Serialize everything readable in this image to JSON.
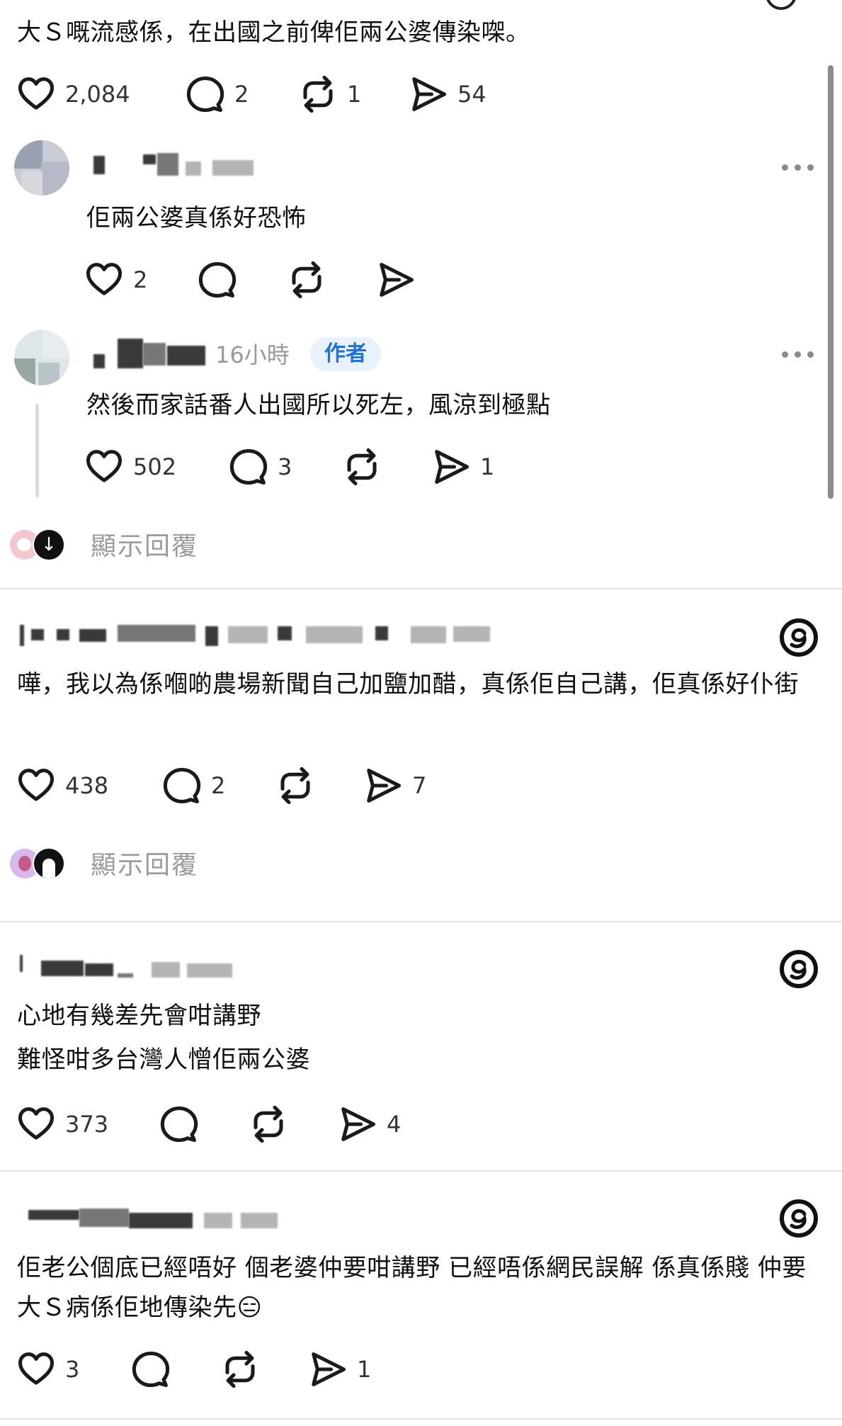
{
  "post": {
    "text": "大Ｓ嘅流感係，在出國之前俾佢兩公婆傳染㗎。",
    "likes": "2,084",
    "comments": "2",
    "reposts": "1",
    "shares": "54"
  },
  "replies": [
    {
      "text": "佢兩公婆真係好恐怖",
      "likes": "2",
      "comments": "",
      "reposts": "",
      "shares": ""
    },
    {
      "time": "16小時",
      "badge": "作者",
      "text": "然後而家話番人出國所以死左，風涼到極點",
      "likes": "502",
      "comments": "3",
      "reposts": "",
      "shares": "1"
    }
  ],
  "show_replies_label": "顯示回覆",
  "comments": [
    {
      "text": "嘩，我以為係嗰啲農場新聞自己加鹽加醋，真係佢自己講，佢真係好仆街",
      "likes": "438",
      "comments": "2",
      "reposts": "",
      "shares": "7",
      "show_replies": "顯示回覆"
    },
    {
      "text_lines": [
        "心地有幾差先會咁講野",
        "難怪咁多台灣人憎佢兩公婆"
      ],
      "likes": "373",
      "comments": "",
      "reposts": "",
      "shares": "4"
    },
    {
      "text": "佢老公個底已經唔好 個老婆仲要咁講野 已經唔係網民誤解 係真係賤 仲要大Ｓ病係佢地傳染先😑",
      "likes": "3",
      "comments": "",
      "reposts": "",
      "shares": "1"
    }
  ]
}
